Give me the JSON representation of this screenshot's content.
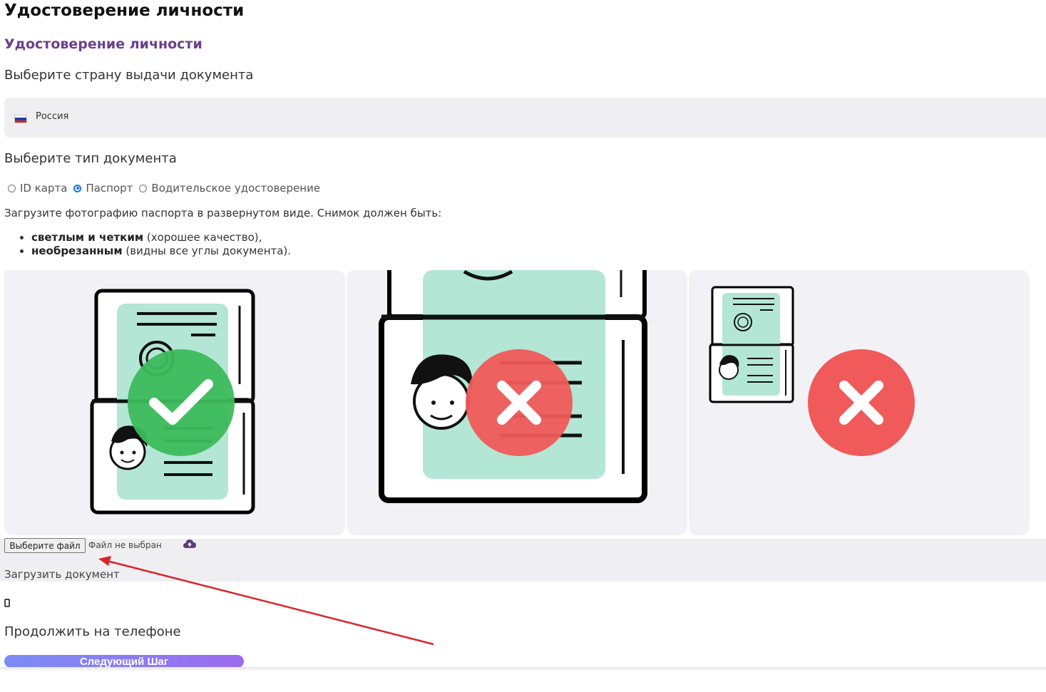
{
  "page_title": "Удостоверение личности",
  "section_title": "Удостоверение личности",
  "country": {
    "heading": "Выберите страну выдачи документа",
    "selected": "Россия",
    "flag_icon": "russia-flag-icon",
    "flag_colors": [
      "#ffffff",
      "#1c3fa8",
      "#d52b1e"
    ]
  },
  "document_type": {
    "heading": "Выберите тип документа",
    "options": [
      {
        "label": "ID карта",
        "checked": false
      },
      {
        "label": "Паспорт",
        "checked": true
      },
      {
        "label": "Водительское удостоверение",
        "checked": false
      }
    ]
  },
  "instructions": {
    "text": "Загрузите фотографию паспорта в развернутом виде. Снимок должен быть:",
    "requirements": [
      {
        "bold": "светлым и четким",
        "rest": " (хорошее качество),"
      },
      {
        "bold": "необрезанным",
        "rest": " (видны все углы документа)."
      }
    ]
  },
  "examples": [
    {
      "status": "good",
      "icon": "check-icon",
      "color": "#3dbb5c"
    },
    {
      "status": "bad",
      "icon": "cross-icon",
      "color": "#f05a5a"
    },
    {
      "status": "bad",
      "icon": "cross-icon",
      "color": "#f05a5a"
    }
  ],
  "upload": {
    "button_label": "Выберите файл",
    "status": "Файл не выбран",
    "cloud_icon": "cloud-upload-icon",
    "label": "Загрузить документ"
  },
  "phone": {
    "icon": "phone-icon",
    "heading": "Продолжить на телефоне"
  },
  "next_button": "Следующий Шаг",
  "colors": {
    "accent_purple": "#6b3f8a",
    "radio_checked": "#1a73e8",
    "panel_bg": "#efeff1",
    "passport_green": "#b4e6d6",
    "arrow": "#d9252b"
  }
}
